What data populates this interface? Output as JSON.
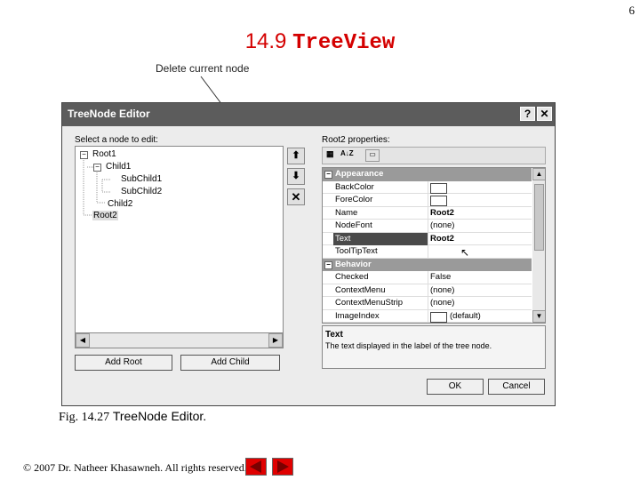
{
  "page": {
    "number": "6"
  },
  "slide": {
    "title_num": "14.9",
    "title_text": "TreeView",
    "annotation": "Delete current node"
  },
  "dialog": {
    "title": "TreeNode Editor",
    "help_btn": "?",
    "close_btn": "✕",
    "select_label": "Select a node to edit:",
    "tree": [
      "Root1",
      "Child1",
      "SubChild1",
      "SubChild2",
      "Child2",
      "Root2"
    ],
    "add_root": "Add Root",
    "add_child": "Add Child",
    "props_label": "Root2 properties:",
    "categories": {
      "appearance": "Appearance",
      "behavior": "Behavior"
    },
    "props_appearance": [
      {
        "name": "BackColor",
        "value": ""
      },
      {
        "name": "ForeColor",
        "value": ""
      },
      {
        "name": "Name",
        "value": "Root2"
      },
      {
        "name": "NodeFont",
        "value": "(none)"
      },
      {
        "name": "Text",
        "value": "Root2"
      },
      {
        "name": "ToolTipText",
        "value": ""
      }
    ],
    "props_behavior": [
      {
        "name": "Checked",
        "value": "False"
      },
      {
        "name": "ContextMenu",
        "value": "(none)"
      },
      {
        "name": "ContextMenuStrip",
        "value": "(none)"
      },
      {
        "name": "ImageIndex",
        "value": "(default)"
      }
    ],
    "desc_title": "Text",
    "desc_text": "The text displayed in the label of the tree node.",
    "ok": "OK",
    "cancel": "Cancel"
  },
  "caption": {
    "fig": "Fig. 14.27",
    "text": "TreeNode Editor."
  },
  "footer": "© 2007 Dr. Natheer Khasawneh. All rights reserved."
}
